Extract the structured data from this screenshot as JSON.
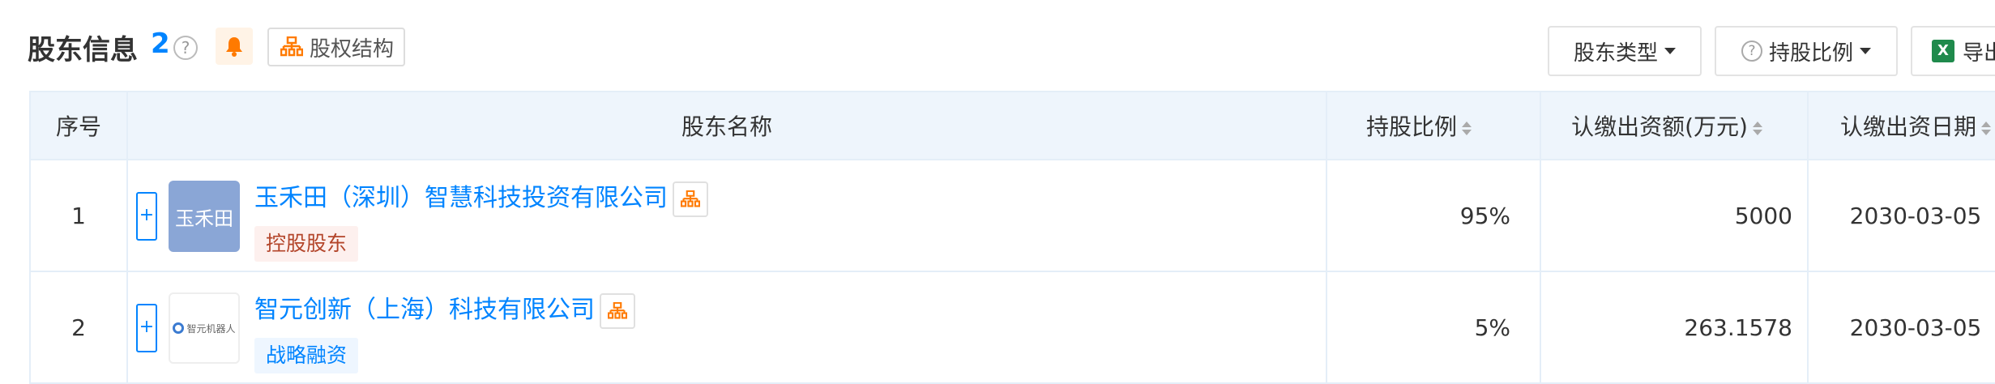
{
  "header": {
    "title": "股东信息",
    "count": "2",
    "help": "?",
    "structure_label": "股权结构",
    "shareholder_type_label": "股东类型",
    "holding_ratio_label": "持股比例",
    "export_label": "导出"
  },
  "table": {
    "columns": {
      "index": "序号",
      "name": "股东名称",
      "ratio": "持股比例",
      "amount": "认缴出资额(万元)",
      "date": "认缴出资日期"
    },
    "rows": [
      {
        "index": "1",
        "logo_text": "玉禾田",
        "name": "玉禾田（深圳）智慧科技投资有限公司",
        "tag": "控股股东",
        "ratio": "95%",
        "amount": "5000",
        "date": "2030-03-05"
      },
      {
        "index": "2",
        "logo_text": "智元机器人",
        "name": "智元创新（上海）科技有限公司",
        "tag": "战略融资",
        "ratio": "5%",
        "amount": "263.1578",
        "date": "2030-03-05"
      }
    ]
  },
  "colors": {
    "accent": "#0084ff",
    "header_bg": "#eef5fc",
    "orange": "#ff7a00"
  },
  "icons": [
    "question-circle-icon",
    "bell-icon",
    "org-structure-icon",
    "caret-down-icon",
    "excel-icon",
    "sort-icon",
    "plus-icon"
  ]
}
